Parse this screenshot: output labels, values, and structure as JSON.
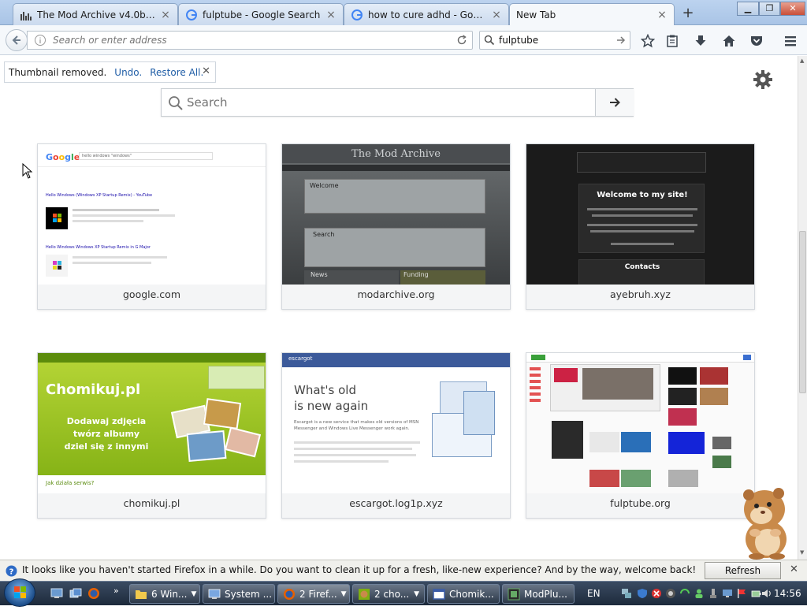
{
  "tabs": [
    {
      "title": "The Mod Archive v4.0b - A...",
      "active": false
    },
    {
      "title": "fulptube - Google Search",
      "active": false
    },
    {
      "title": "how to cure adhd - Google...",
      "active": false
    },
    {
      "title": "New Tab",
      "active": true
    }
  ],
  "navbar": {
    "url_placeholder": "Search or enter address",
    "search_value": "fulptube"
  },
  "undo_bar": {
    "message": "Thumbnail removed.",
    "undo": "Undo.",
    "restore": "Restore All."
  },
  "newtab_search": {
    "placeholder": "Search"
  },
  "tiles": [
    {
      "label": "google.com"
    },
    {
      "label": "modarchive.org"
    },
    {
      "label": "ayebruh.xyz"
    },
    {
      "label": "chomikuj.pl"
    },
    {
      "label": "escargot.log1p.xyz"
    },
    {
      "label": "fulptube.org"
    }
  ],
  "thumbs": {
    "google": {
      "query": "hello windows \"windows\"",
      "result1_title": "Hello Windows (Windows XP Startup Remix) - YouTube",
      "result2_title": "Hello Windows Windows XP Startup Remix in G Major"
    },
    "modarchive": {
      "title": "The Mod Archive",
      "welcome": "Welcome",
      "search": "Search",
      "news": "News",
      "funding": "Funding"
    },
    "ayebruh": {
      "welcome": "Welcome to my site!",
      "contacts": "Contacts"
    },
    "chomikuj": {
      "logo": "Chomikuj.pl",
      "line1": "Dodawaj zdjęcia",
      "line2": "twórz albumy",
      "line3": "dziel się z innymi",
      "footer": "Jak działa serwis?"
    },
    "escargot": {
      "brand": "escargot",
      "headline1": "What's old",
      "headline2": "is new again",
      "body": "Escargot is a new service that makes old versions of MSN Messenger and Windows Live Messenger work again."
    }
  },
  "notification": {
    "text": "It looks like you haven't started Firefox in a while. Do you want to clean it up for a fresh, like-new experience? And by the way, welcome back!",
    "button": "Refresh Firefox..."
  },
  "taskbar": {
    "items": [
      {
        "label": "6 Win..."
      },
      {
        "label": "System ..."
      },
      {
        "label": "2 Firef..."
      },
      {
        "label": "2 cho..."
      },
      {
        "label": "Chomik..."
      },
      {
        "label": "ModPlu..."
      }
    ],
    "language": "EN",
    "clock": "14:56"
  },
  "colors": {
    "accent": "#1f5da6",
    "tab_strip": "#bcd3ef",
    "taskbar": "#1d2a3b"
  }
}
